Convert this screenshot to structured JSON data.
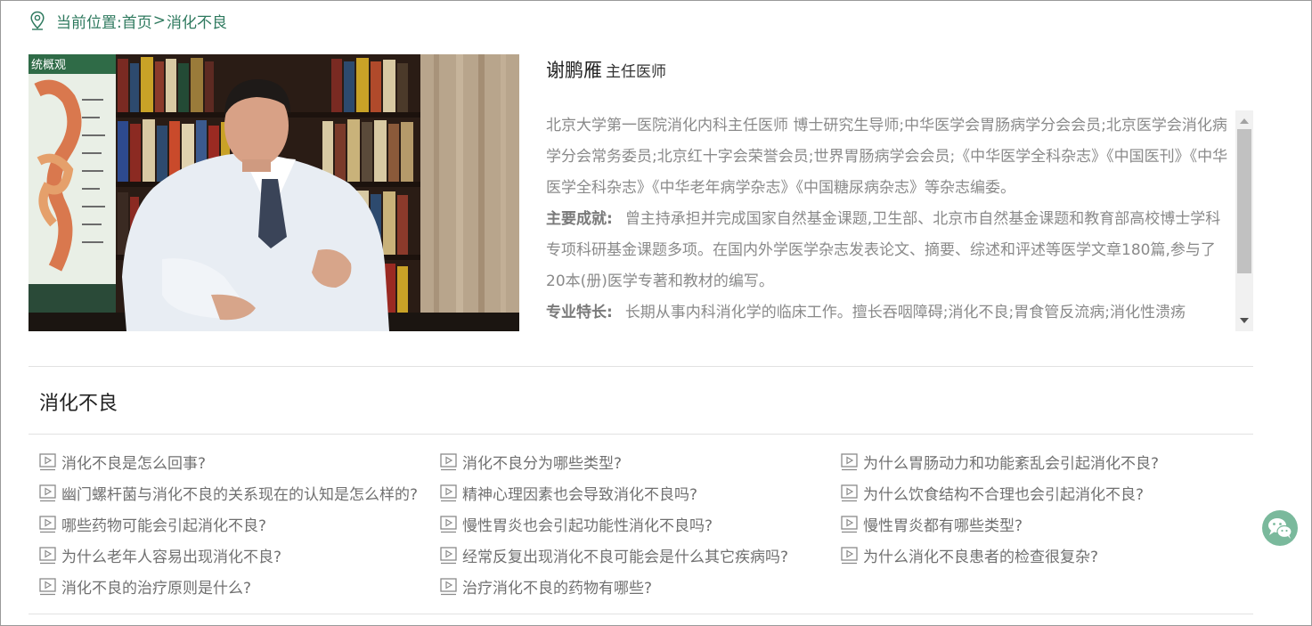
{
  "breadcrumb": {
    "prefix": "当前位置:",
    "home": "首页",
    "separator": ">",
    "current": "消化不良"
  },
  "video": {
    "banner_text": "统概观"
  },
  "doctor": {
    "name": "谢鹏雁",
    "title": "主任医师",
    "bio_intro": "北京大学第一医院消化内科主任医师 博士研究生导师;中华医学会胃肠病学分会会员;北京医学会消化病学分会常务委员;北京红十字会荣誉会员;世界胃肠病学会会员;《中华医学全科杂志》《中国医刊》《中华医学全科杂志》《中华老年病学杂志》《中国糖尿病杂志》等杂志编委。",
    "achievements_label": "主要成就:",
    "achievements": "曾主持承担并完成国家自然基金课题,卫生部、北京市自然基金课题和教育部高校博士学科专项科研基金课题多项。在国内外学医学杂志发表论文、摘要、综述和评述等医学文章180篇,参与了20本(册)医学专著和教材的编写。",
    "specialty_label": "专业特长:",
    "specialty": "长期从事内科消化学的临床工作。擅长吞咽障碍;消化不良;胃食管反流病;消化性溃疡"
  },
  "section": {
    "title": "消化不良"
  },
  "questions": [
    "消化不良是怎么回事?",
    "消化不良分为哪些类型?",
    "为什么胃肠动力和功能紊乱会引起消化不良?",
    "幽门螺杆菌与消化不良的关系现在的认知是怎么样的?",
    "精神心理因素也会导致消化不良吗?",
    "为什么饮食结构不合理也会引起消化不良?",
    "哪些药物可能会引起消化不良?",
    "慢性胃炎也会引起功能性消化不良吗?",
    "慢性胃炎都有哪些类型?",
    "为什么老年人容易出现消化不良?",
    "经常反复出现消化不良可能会是什么其它疾病吗?",
    "为什么消化不良患者的检查很复杂?",
    "消化不良的治疗原则是什么?",
    "治疗消化不良的药物有哪些?"
  ],
  "colors": {
    "accent": "#2f7a5f",
    "text_muted": "#8a8a8a",
    "wechat": "#7ab99c"
  },
  "icons": {
    "location": "location-pin-icon",
    "play": "play-icon",
    "wechat": "wechat-icon"
  }
}
